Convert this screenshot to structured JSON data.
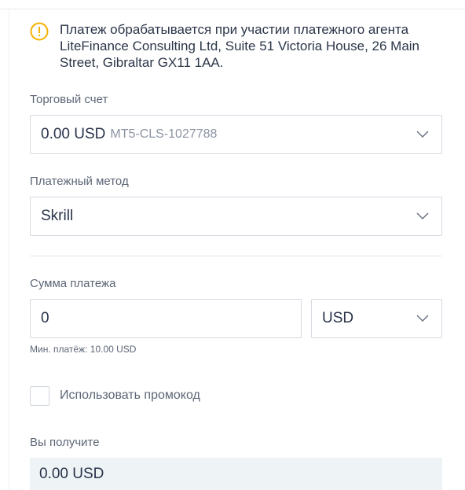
{
  "notice": {
    "icon": "warning-circle-icon",
    "icon_color": "#f5b000",
    "text": "Платеж обрабатывается при участии платежного агента LiteFinance Consulting Ltd, Suite 51 Victoria House, 26 Main Street, Gibraltar GX11 1AA."
  },
  "account": {
    "label": "Торговый счет",
    "value": "0.00 USD",
    "account_id": "MT5-CLS-1027788"
  },
  "method": {
    "label": "Платежный метод",
    "value": "Skrill"
  },
  "amount": {
    "label": "Сумма платежа",
    "value": "0",
    "currency": "USD",
    "hint": "Мин. платёж: 10.00 USD"
  },
  "promo": {
    "label": "Использовать промокод",
    "checked": false
  },
  "receive": {
    "label": "Вы получите",
    "value": "0.00 USD"
  }
}
